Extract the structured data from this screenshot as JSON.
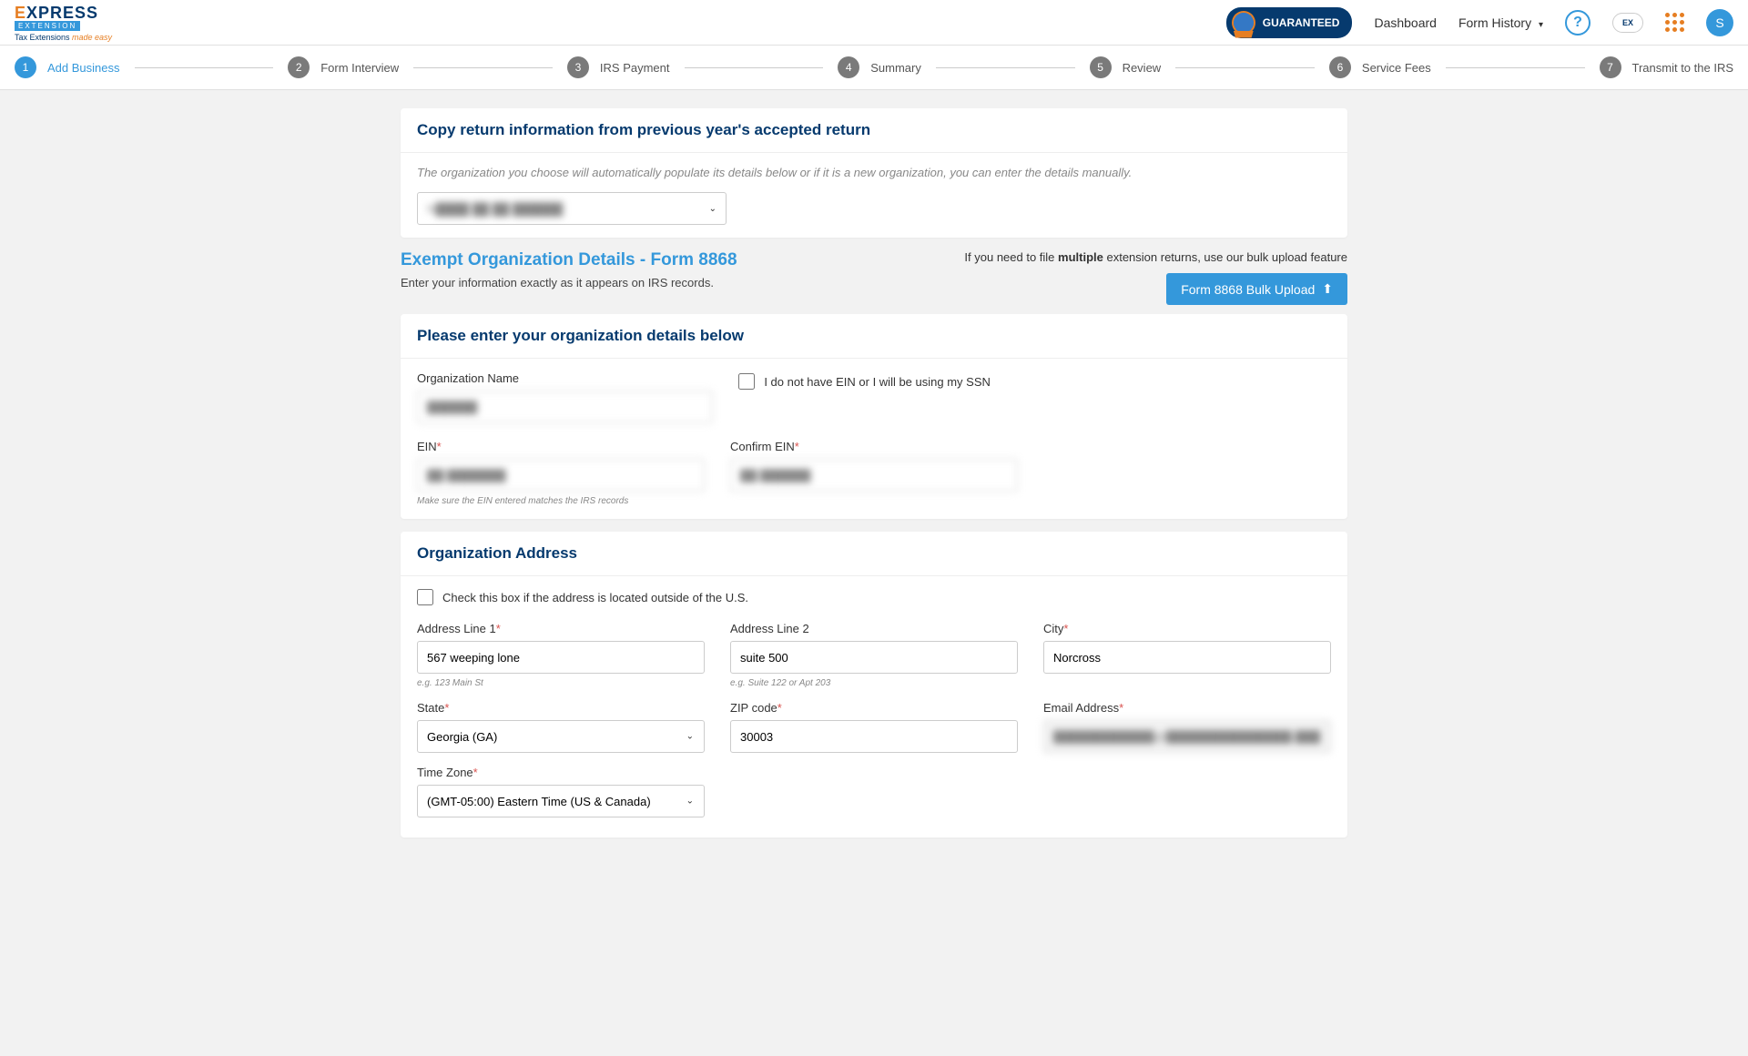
{
  "header": {
    "logo_text1": "E",
    "logo_text2": "XPRESS",
    "logo_ext": "EXTENSION",
    "logo_tag1": "Tax Extensions ",
    "logo_tag2": "made easy",
    "guaranteed": "GUARANTEED",
    "dashboard": "Dashboard",
    "form_history": "Form History",
    "help": "?",
    "ex": "EX",
    "avatar": "S"
  },
  "stepper": [
    {
      "num": "1",
      "label": "Add Business",
      "active": true
    },
    {
      "num": "2",
      "label": "Form Interview",
      "active": false
    },
    {
      "num": "3",
      "label": "IRS Payment",
      "active": false
    },
    {
      "num": "4",
      "label": "Summary",
      "active": false
    },
    {
      "num": "5",
      "label": "Review",
      "active": false
    },
    {
      "num": "6",
      "label": "Service Fees",
      "active": false
    },
    {
      "num": "7",
      "label": "Transmit to the IRS",
      "active": false
    }
  ],
  "copy_card": {
    "title": "Copy return information from previous year's accepted return",
    "helper": "The organization you choose will automatically populate its details below or if it is a new organization, you can enter the details manually.",
    "select_value": "N████ ██ ██ ██████"
  },
  "exempt": {
    "title": "Exempt Organization Details - Form 8868",
    "sub": "Enter your information exactly as it appears on IRS records.",
    "bulk_note_pre": "If you need to file ",
    "bulk_note_bold": "multiple",
    "bulk_note_post": " extension returns, use our bulk upload feature",
    "bulk_btn": "Form 8868 Bulk Upload"
  },
  "org_card": {
    "title": "Please enter your organization details below",
    "org_name_label": "Organization Name",
    "org_name_value": "██████",
    "no_ein_label": "I do not have EIN or I will be using my SSN",
    "ein_label": "EIN",
    "ein_value": "██ ███████",
    "ein_hint": "Make sure the EIN entered matches the IRS records",
    "confirm_ein_label": "Confirm EIN",
    "confirm_ein_value": "██ ██████"
  },
  "addr_card": {
    "title": "Organization Address",
    "outside_us": "Check this box if the address is located outside of the U.S.",
    "line1_label": "Address Line 1",
    "line1_value": "567 weeping lone",
    "line1_hint": "e.g. 123 Main St",
    "line2_label": "Address Line 2",
    "line2_value": "suite 500",
    "line2_hint": "e.g. Suite 122 or Apt 203",
    "city_label": "City",
    "city_value": "Norcross",
    "state_label": "State",
    "state_value": "Georgia (GA)",
    "zip_label": "ZIP code",
    "zip_value": "30003",
    "email_label": "Email Address",
    "email_value": "████████████@███████████████.███",
    "tz_label": "Time Zone",
    "tz_value": "(GMT-05:00) Eastern Time (US & Canada)"
  }
}
